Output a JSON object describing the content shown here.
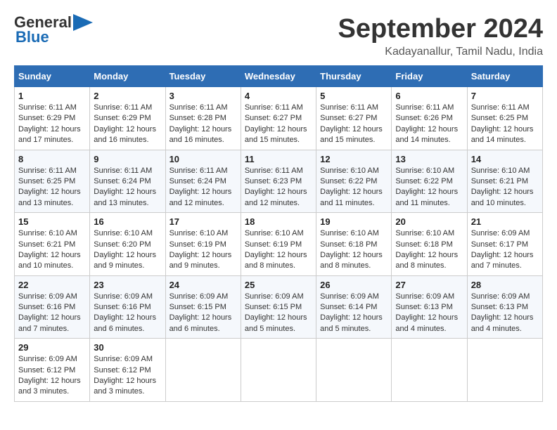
{
  "header": {
    "logo_line1": "General",
    "logo_line2": "Blue",
    "month_title": "September 2024",
    "location": "Kadayanallur, Tamil Nadu, India"
  },
  "columns": [
    "Sunday",
    "Monday",
    "Tuesday",
    "Wednesday",
    "Thursday",
    "Friday",
    "Saturday"
  ],
  "weeks": [
    [
      {
        "day": "1",
        "sunrise": "Sunrise: 6:11 AM",
        "sunset": "Sunset: 6:29 PM",
        "daylight": "Daylight: 12 hours and 17 minutes."
      },
      {
        "day": "2",
        "sunrise": "Sunrise: 6:11 AM",
        "sunset": "Sunset: 6:29 PM",
        "daylight": "Daylight: 12 hours and 16 minutes."
      },
      {
        "day": "3",
        "sunrise": "Sunrise: 6:11 AM",
        "sunset": "Sunset: 6:28 PM",
        "daylight": "Daylight: 12 hours and 16 minutes."
      },
      {
        "day": "4",
        "sunrise": "Sunrise: 6:11 AM",
        "sunset": "Sunset: 6:27 PM",
        "daylight": "Daylight: 12 hours and 15 minutes."
      },
      {
        "day": "5",
        "sunrise": "Sunrise: 6:11 AM",
        "sunset": "Sunset: 6:27 PM",
        "daylight": "Daylight: 12 hours and 15 minutes."
      },
      {
        "day": "6",
        "sunrise": "Sunrise: 6:11 AM",
        "sunset": "Sunset: 6:26 PM",
        "daylight": "Daylight: 12 hours and 14 minutes."
      },
      {
        "day": "7",
        "sunrise": "Sunrise: 6:11 AM",
        "sunset": "Sunset: 6:25 PM",
        "daylight": "Daylight: 12 hours and 14 minutes."
      }
    ],
    [
      {
        "day": "8",
        "sunrise": "Sunrise: 6:11 AM",
        "sunset": "Sunset: 6:25 PM",
        "daylight": "Daylight: 12 hours and 13 minutes."
      },
      {
        "day": "9",
        "sunrise": "Sunrise: 6:11 AM",
        "sunset": "Sunset: 6:24 PM",
        "daylight": "Daylight: 12 hours and 13 minutes."
      },
      {
        "day": "10",
        "sunrise": "Sunrise: 6:11 AM",
        "sunset": "Sunset: 6:24 PM",
        "daylight": "Daylight: 12 hours and 12 minutes."
      },
      {
        "day": "11",
        "sunrise": "Sunrise: 6:11 AM",
        "sunset": "Sunset: 6:23 PM",
        "daylight": "Daylight: 12 hours and 12 minutes."
      },
      {
        "day": "12",
        "sunrise": "Sunrise: 6:10 AM",
        "sunset": "Sunset: 6:22 PM",
        "daylight": "Daylight: 12 hours and 11 minutes."
      },
      {
        "day": "13",
        "sunrise": "Sunrise: 6:10 AM",
        "sunset": "Sunset: 6:22 PM",
        "daylight": "Daylight: 12 hours and 11 minutes."
      },
      {
        "day": "14",
        "sunrise": "Sunrise: 6:10 AM",
        "sunset": "Sunset: 6:21 PM",
        "daylight": "Daylight: 12 hours and 10 minutes."
      }
    ],
    [
      {
        "day": "15",
        "sunrise": "Sunrise: 6:10 AM",
        "sunset": "Sunset: 6:21 PM",
        "daylight": "Daylight: 12 hours and 10 minutes."
      },
      {
        "day": "16",
        "sunrise": "Sunrise: 6:10 AM",
        "sunset": "Sunset: 6:20 PM",
        "daylight": "Daylight: 12 hours and 9 minutes."
      },
      {
        "day": "17",
        "sunrise": "Sunrise: 6:10 AM",
        "sunset": "Sunset: 6:19 PM",
        "daylight": "Daylight: 12 hours and 9 minutes."
      },
      {
        "day": "18",
        "sunrise": "Sunrise: 6:10 AM",
        "sunset": "Sunset: 6:19 PM",
        "daylight": "Daylight: 12 hours and 8 minutes."
      },
      {
        "day": "19",
        "sunrise": "Sunrise: 6:10 AM",
        "sunset": "Sunset: 6:18 PM",
        "daylight": "Daylight: 12 hours and 8 minutes."
      },
      {
        "day": "20",
        "sunrise": "Sunrise: 6:10 AM",
        "sunset": "Sunset: 6:18 PM",
        "daylight": "Daylight: 12 hours and 8 minutes."
      },
      {
        "day": "21",
        "sunrise": "Sunrise: 6:09 AM",
        "sunset": "Sunset: 6:17 PM",
        "daylight": "Daylight: 12 hours and 7 minutes."
      }
    ],
    [
      {
        "day": "22",
        "sunrise": "Sunrise: 6:09 AM",
        "sunset": "Sunset: 6:16 PM",
        "daylight": "Daylight: 12 hours and 7 minutes."
      },
      {
        "day": "23",
        "sunrise": "Sunrise: 6:09 AM",
        "sunset": "Sunset: 6:16 PM",
        "daylight": "Daylight: 12 hours and 6 minutes."
      },
      {
        "day": "24",
        "sunrise": "Sunrise: 6:09 AM",
        "sunset": "Sunset: 6:15 PM",
        "daylight": "Daylight: 12 hours and 6 minutes."
      },
      {
        "day": "25",
        "sunrise": "Sunrise: 6:09 AM",
        "sunset": "Sunset: 6:15 PM",
        "daylight": "Daylight: 12 hours and 5 minutes."
      },
      {
        "day": "26",
        "sunrise": "Sunrise: 6:09 AM",
        "sunset": "Sunset: 6:14 PM",
        "daylight": "Daylight: 12 hours and 5 minutes."
      },
      {
        "day": "27",
        "sunrise": "Sunrise: 6:09 AM",
        "sunset": "Sunset: 6:13 PM",
        "daylight": "Daylight: 12 hours and 4 minutes."
      },
      {
        "day": "28",
        "sunrise": "Sunrise: 6:09 AM",
        "sunset": "Sunset: 6:13 PM",
        "daylight": "Daylight: 12 hours and 4 minutes."
      }
    ],
    [
      {
        "day": "29",
        "sunrise": "Sunrise: 6:09 AM",
        "sunset": "Sunset: 6:12 PM",
        "daylight": "Daylight: 12 hours and 3 minutes."
      },
      {
        "day": "30",
        "sunrise": "Sunrise: 6:09 AM",
        "sunset": "Sunset: 6:12 PM",
        "daylight": "Daylight: 12 hours and 3 minutes."
      },
      null,
      null,
      null,
      null,
      null
    ]
  ]
}
